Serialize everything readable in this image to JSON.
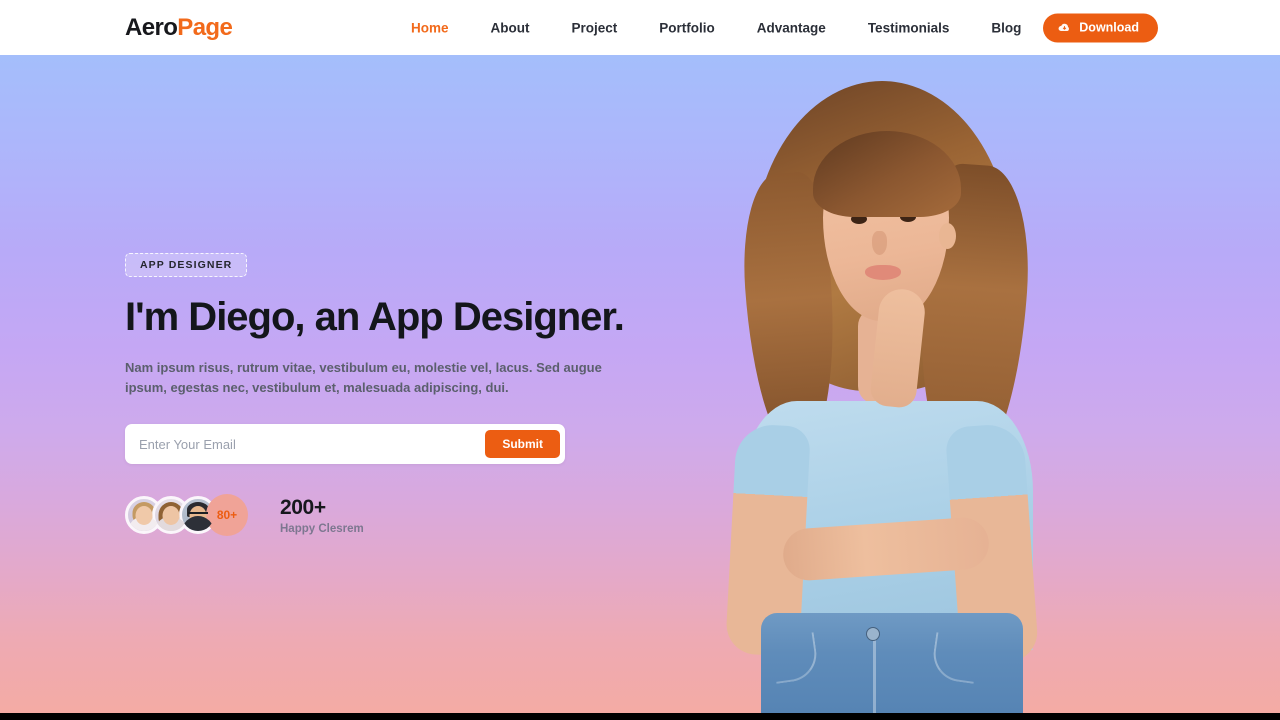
{
  "header": {
    "logo": {
      "part1": "Aero",
      "part2": "Page"
    },
    "nav": [
      {
        "label": "Home",
        "active": true
      },
      {
        "label": "About",
        "active": false
      },
      {
        "label": "Project",
        "active": false
      },
      {
        "label": "Portfolio",
        "active": false
      },
      {
        "label": "Advantage",
        "active": false
      },
      {
        "label": "Testimonials",
        "active": false
      },
      {
        "label": "Blog",
        "active": false
      }
    ],
    "download_button": {
      "label": "Download",
      "icon": "cloud-download-icon"
    }
  },
  "hero": {
    "badge": "APP DESIGNER",
    "title": "I'm Diego, an App Designer.",
    "subtitle": "Nam ipsum risus, rutrum vitae, vestibulum eu, molestie vel, lacus. Sed augue ipsum, egestas nec, vestibulum et, malesuada adipiscing, dui.",
    "form": {
      "placeholder": "Enter Your Email",
      "value": "",
      "submit_label": "Submit"
    },
    "social_proof": {
      "more_badge": "80+",
      "count": "200+",
      "label": "Happy Clesrem",
      "avatar_count": 3
    },
    "image_alt": "woman-thinking-photo"
  },
  "colors": {
    "accent": "#ec5d12",
    "logo_accent": "#f26a1b",
    "heading": "#14161b",
    "body_text": "#5b5f6d",
    "gradient_top": "#a4befb",
    "gradient_mid": "#c5a7f4",
    "gradient_bottom": "#f4aba4",
    "badge_more_bg": "#f0a397"
  }
}
